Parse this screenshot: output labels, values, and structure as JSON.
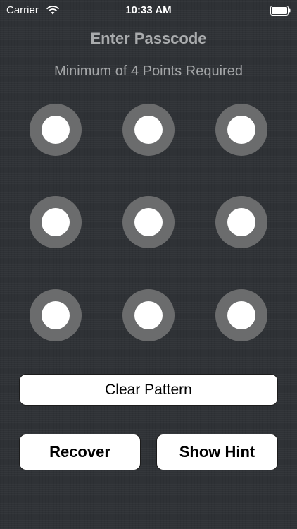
{
  "status_bar": {
    "carrier": "Carrier",
    "time": "10:33 AM"
  },
  "screen": {
    "title": "Enter Passcode",
    "subtitle": "Minimum of 4 Points Required"
  },
  "pattern": {
    "rows": 3,
    "cols": 3,
    "outer_ring_color": "#6b6c6d",
    "inner_dot_color": "#ffffff"
  },
  "buttons": {
    "clear": "Clear Pattern",
    "recover": "Recover",
    "show_hint": "Show Hint"
  },
  "colors": {
    "background": "#2f3236",
    "title_text": "#a9abad",
    "button_bg": "#ffffff",
    "button_text": "#000000"
  },
  "icons": {
    "wifi": "wifi-icon",
    "battery": "battery-icon"
  }
}
